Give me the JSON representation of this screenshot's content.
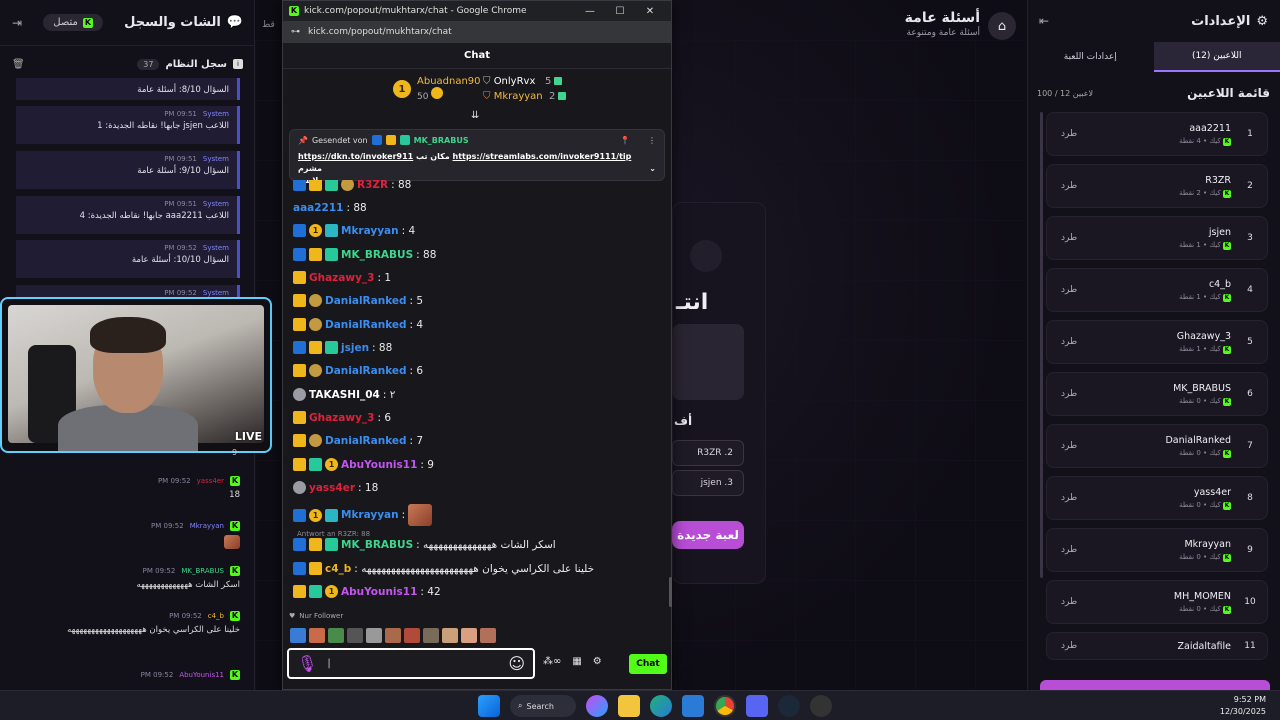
{
  "left_panel": {
    "title": "الشات والسجل",
    "online": "متصل",
    "log_title": "سجل النظام",
    "log_count": "37",
    "messages": [
      {
        "text": "السؤال 8/10: أسئلة عامة"
      },
      {
        "time": "09:51 PM",
        "sender": "System",
        "text": "اللاعب jsjen جابها! نقاطه الجديدة: 1"
      },
      {
        "time": "09:51 PM",
        "sender": "System",
        "text": "السؤال 9/10: أسئلة عامة"
      },
      {
        "time": "09:51 PM",
        "sender": "System",
        "text": "اللاعب aaa2211 جابها! نقاطه الجديدة: 4"
      },
      {
        "time": "09:52 PM",
        "sender": "System",
        "text": "السؤال 10/10: أسئلة عامة"
      },
      {
        "time": "09:52 PM",
        "sender": "System"
      }
    ],
    "chats": [
      {
        "time": "09:52 PM",
        "user": "yass4er",
        "text": "18"
      },
      {
        "time": "09:52 PM",
        "user": "Mkrayyan",
        "text": ""
      },
      {
        "time": "09:52 PM",
        "user": "MK_BRABUS",
        "text": "اسكر الشات هههههههههههههه"
      },
      {
        "time": "09:52 PM",
        "user": "c4_b",
        "text": "خلينا على الكراسي يخوان هههههههههههههههههههه"
      },
      {
        "time": "09:52 PM",
        "user": "AbuYounis11",
        "text": ""
      }
    ],
    "chat_extra": "9",
    "live_label": "LIVE"
  },
  "center": {
    "title": "أسئلة عامة",
    "subtitle": "أسئلة عامة ومتنوعة",
    "big_text": "انتـ",
    "partial_label": "أف",
    "answers": [
      "R3ZR .2",
      "jsjen .3"
    ],
    "new_game": "لعبة جديدة",
    "left_edge_text": "قط"
  },
  "right_panel": {
    "title": "الإعدادات",
    "tabs": [
      "اللاعبين (12)",
      "إعدادات اللعبة"
    ],
    "list_title": "قائمة اللاعبين",
    "list_count": "100 / 12 لاعبين",
    "kick_label": "طرد",
    "players": [
      {
        "rank": "1",
        "name": "aaa2211",
        "sub": "كيك • 4 نقطة"
      },
      {
        "rank": "2",
        "name": "R3ZR",
        "sub": "كيك • 2 نقطة"
      },
      {
        "rank": "3",
        "name": "jsjen",
        "sub": "كيك • 1 نقطة"
      },
      {
        "rank": "4",
        "name": "c4_b",
        "sub": "كيك • 1 نقطة"
      },
      {
        "rank": "5",
        "name": "Ghazawy_3",
        "sub": "كيك • 1 نقطة"
      },
      {
        "rank": "6",
        "name": "MK_BRABUS",
        "sub": "كيك • 0 نقطة"
      },
      {
        "rank": "7",
        "name": "DanialRanked",
        "sub": "كيك • 0 نقطة"
      },
      {
        "rank": "8",
        "name": "yass4er",
        "sub": "كيك • 0 نقطة"
      },
      {
        "rank": "9",
        "name": "Mkrayyan",
        "sub": "كيك • 0 نقطة"
      },
      {
        "rank": "10",
        "name": "MH_MOMEN",
        "sub": "كيك • 0 نقطة"
      },
      {
        "rank": "11",
        "name": "Zaidaltafile",
        "sub": ""
      }
    ]
  },
  "popup": {
    "window_title": "kick.com/popout/mukhtarx/chat - Google Chrome",
    "url": "kick.com/popout/mukhtarx/chat",
    "chat_header": "Chat",
    "leader1": {
      "name": "Abuadnan90",
      "score": "50"
    },
    "leader2": {
      "name": "OnlyRvx",
      "score": "5"
    },
    "leader3": {
      "name": "Mkrayyan",
      "score": "2"
    },
    "pinned": {
      "sent_by": "Gesendet von",
      "sender": "MK_BRABUS",
      "link1": "https://dkn.to/invoker911",
      "mid": "مكان تب",
      "link2": "https://streamlabs.com/invoker9111/tip",
      "tail": "مشرم",
      "line2": "لايس"
    },
    "messages": [
      {
        "user": "R3ZR",
        "text": ": 88",
        "color": "#e0213b",
        "badges": [
          "mod",
          "crown",
          "og",
          "wreath"
        ]
      },
      {
        "user": "aaa2211",
        "text": ": 88",
        "color": "#3b8df0",
        "badges": []
      },
      {
        "user": "Mkrayyan",
        "text": ": 4",
        "color": "#3b8df0",
        "badges": [
          "mod",
          "one",
          "sub"
        ]
      },
      {
        "user": "MK_BRABUS",
        "text": ": 88",
        "color": "#3dd68c",
        "badges": [
          "mod",
          "crown",
          "og"
        ]
      },
      {
        "user": "Ghazawy_3",
        "text": ": 1",
        "color": "#e0213b",
        "badges": [
          "crown"
        ]
      },
      {
        "user": "DanialRanked",
        "text": ": 5",
        "color": "#3b8df0",
        "badges": [
          "crown",
          "wreath"
        ]
      },
      {
        "user": "DanialRanked",
        "text": ": 4",
        "color": "#3b8df0",
        "badges": [
          "crown",
          "wreath"
        ]
      },
      {
        "user": "jsjen",
        "text": ": 88",
        "color": "#3b8df0",
        "badges": [
          "mod",
          "crown",
          "og"
        ]
      },
      {
        "user": "DanialRanked",
        "text": ": 6",
        "color": "#3b8df0",
        "badges": [
          "crown",
          "wreath"
        ]
      },
      {
        "user": "TAKASHI_04",
        "text": ": ٢",
        "color": "#ffffff",
        "badges": [
          "shield"
        ]
      },
      {
        "user": "Ghazawy_3",
        "text": ": 6",
        "color": "#e0213b",
        "badges": [
          "crown"
        ]
      },
      {
        "user": "DanialRanked",
        "text": ": 7",
        "color": "#3b8df0",
        "badges": [
          "crown",
          "wreath"
        ]
      },
      {
        "user": "AbuYounis11",
        "text": ": 9",
        "color": "#c455f0",
        "badges": [
          "crown",
          "og",
          "one"
        ]
      },
      {
        "user": "yass4er",
        "text": ": 18",
        "color": "#e0213b",
        "badges": [
          "shield"
        ]
      },
      {
        "user": "Mkrayyan",
        "text": ":",
        "color": "#3b8df0",
        "badges": [
          "mod",
          "one",
          "sub"
        ]
      },
      {
        "user": "MK_BRABUS",
        "text": ": اسكر الشات ههههههههههههههه",
        "color": "#3dd68c",
        "badges": [
          "mod",
          "crown",
          "og"
        ]
      },
      {
        "user": "c4_b",
        "text": ": خلينا على الكراسي يخوان هههههههههههههههههههههههه",
        "color": "#f0b71d",
        "badges": [
          "mod",
          "crown"
        ]
      },
      {
        "user": "AbuYounis11",
        "text": ": 42",
        "color": "#c455f0",
        "badges": [
          "crown",
          "og",
          "one"
        ]
      }
    ],
    "reply_label": "Antwort an R3ZR: 88",
    "follower_label": "Nur Follower",
    "chat_button": "Chat"
  },
  "taskbar": {
    "search": "Search",
    "time": "9:52 PM",
    "date": "12/30/2025"
  }
}
